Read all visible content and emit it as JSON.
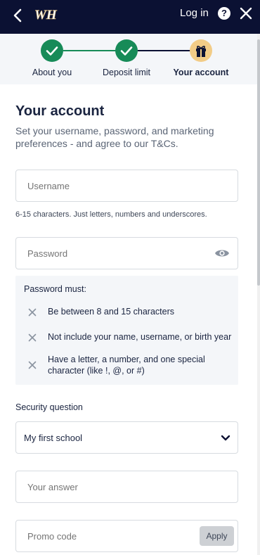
{
  "header": {
    "logo_text": "WH",
    "login_label": "Log in",
    "help_label": "?"
  },
  "stepper": {
    "steps": [
      {
        "label": "About you",
        "state": "done"
      },
      {
        "label": "Deposit limit",
        "state": "done"
      },
      {
        "label": "Your account",
        "state": "current"
      }
    ]
  },
  "page": {
    "title": "Your account",
    "subtitle": "Set your username, password, and marketing preferences - and agree to our T&Cs."
  },
  "username": {
    "placeholder": "Username",
    "hint": "6-15 characters. Just letters, numbers and underscores."
  },
  "password": {
    "placeholder": "Password",
    "rules_heading": "Password must:",
    "rules": [
      "Be between 8 and 15 characters",
      "Not include your name, username, or birth year",
      "Have a letter, a number, and one special character (like !, @, or #)"
    ]
  },
  "security": {
    "label": "Security question",
    "selected": "My first school",
    "answer_placeholder": "Your answer"
  },
  "promo": {
    "placeholder": "Promo code",
    "apply_label": "Apply"
  },
  "colors": {
    "header_bg": "#0b1133",
    "step_done": "#178b58",
    "step_current": "#f2cc87",
    "rules_bg": "#f4f6f9"
  }
}
